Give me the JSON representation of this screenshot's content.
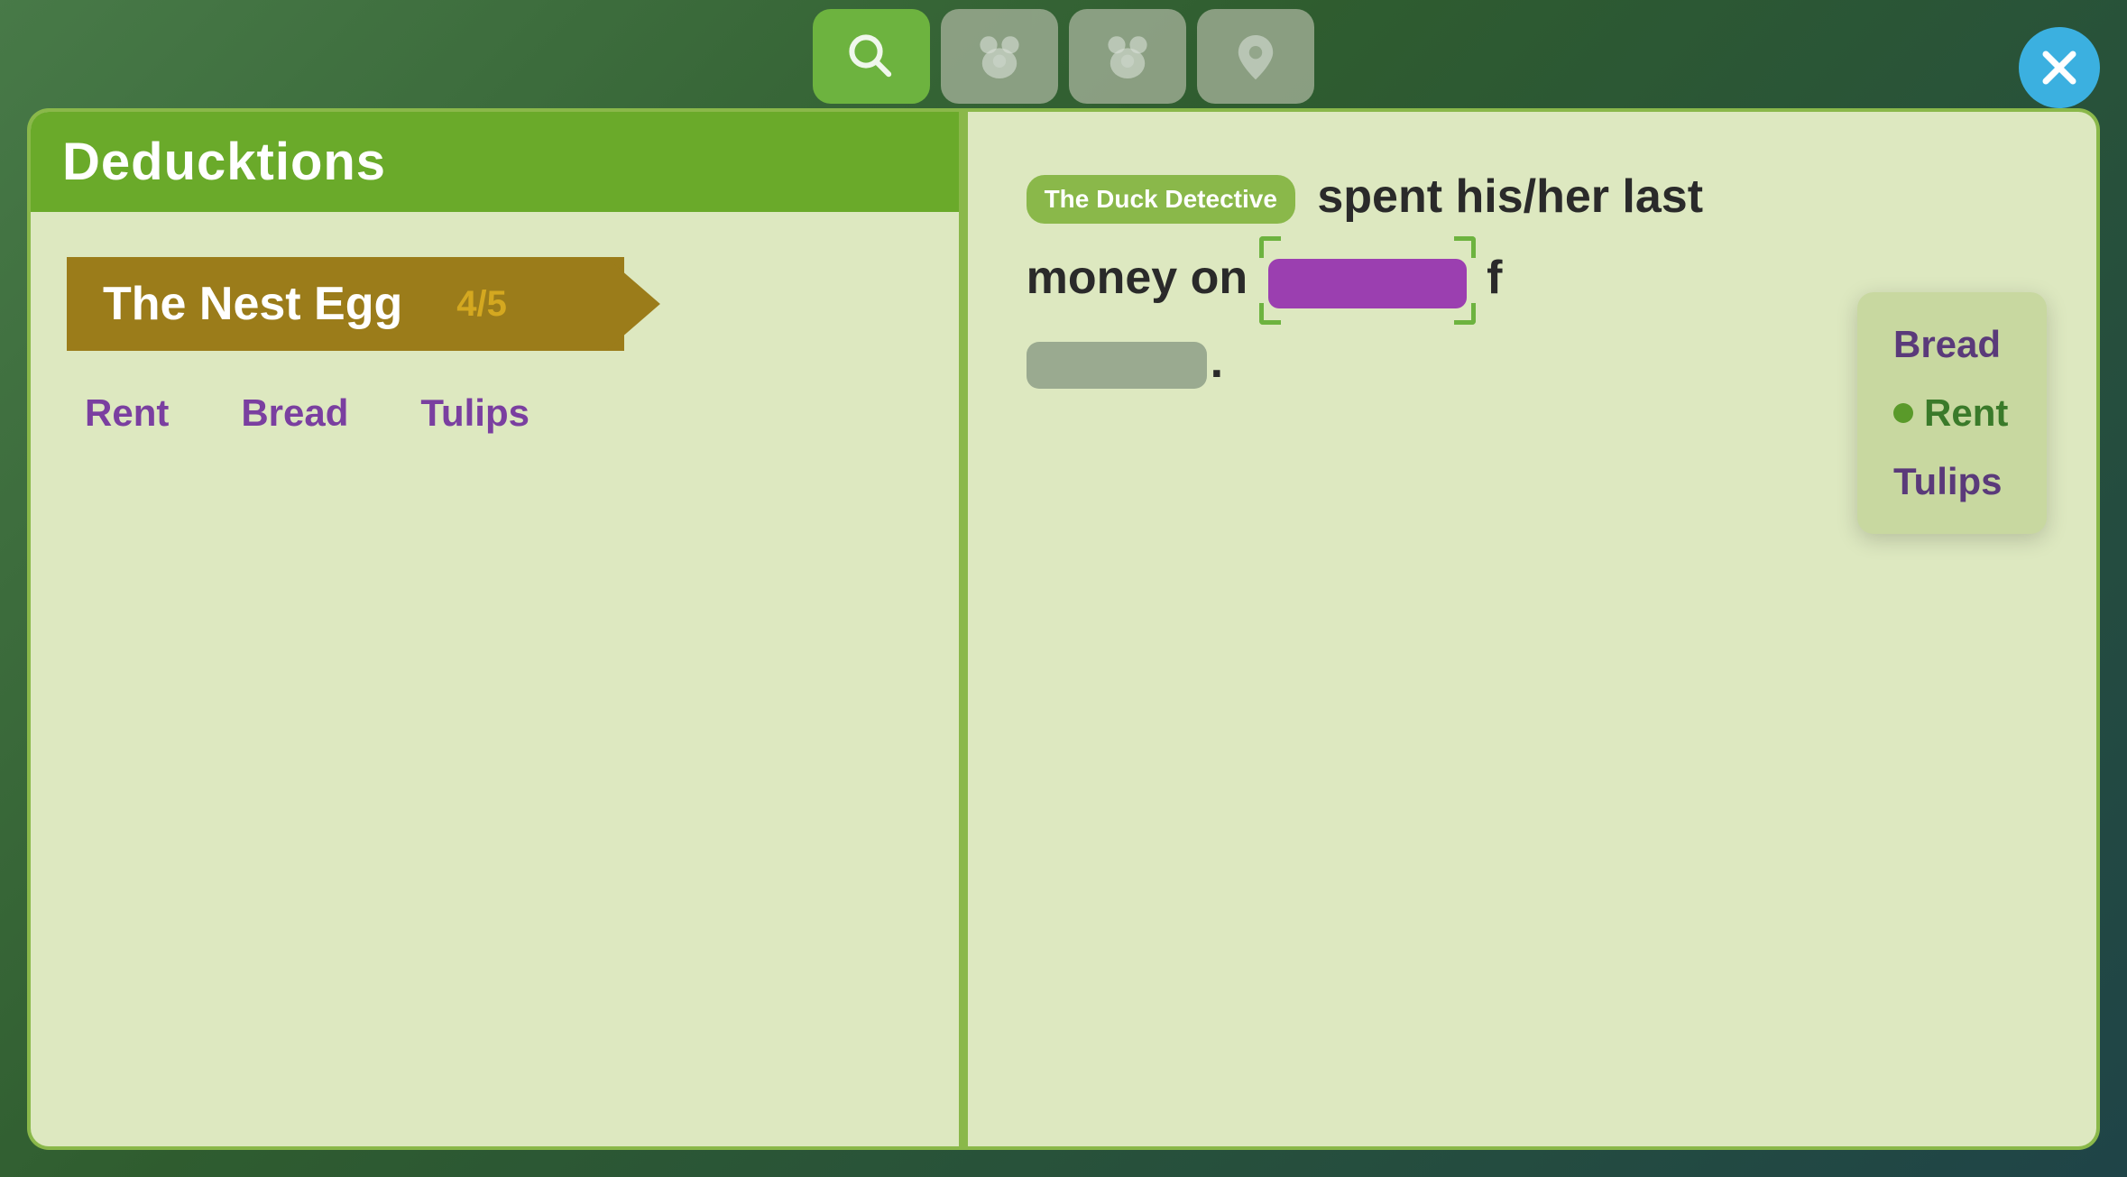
{
  "background": {
    "color": "#3a6b3a"
  },
  "topNav": {
    "tabs": [
      {
        "id": "search",
        "icon": "search",
        "active": true,
        "label": "Search Tab"
      },
      {
        "id": "bear1",
        "icon": "bear",
        "active": false,
        "label": "Bear Tab 1"
      },
      {
        "id": "bear2",
        "icon": "bear",
        "active": false,
        "label": "Bear Tab 2"
      },
      {
        "id": "location",
        "icon": "location",
        "active": false,
        "label": "Location Tab"
      }
    ]
  },
  "closeButton": {
    "label": "×"
  },
  "leftPage": {
    "header": {
      "title": "Deducktions"
    },
    "chapterBanner": {
      "title": "The Nest Egg",
      "progress": "4/5"
    },
    "clueItems": [
      "Rent",
      "Bread",
      "Tulips"
    ]
  },
  "rightPage": {
    "detectiveBadge": "The Duck Detective",
    "textParts": {
      "part1": "spent his/her last",
      "part2": "money on",
      "part3": "f",
      "endPunctuation": "."
    },
    "selectedBlank": "Rent",
    "answerBlankVisible": true
  },
  "dropdown": {
    "items": [
      {
        "label": "Bread",
        "selected": false
      },
      {
        "label": "Rent",
        "selected": true
      },
      {
        "label": "Tulips",
        "selected": false
      }
    ]
  }
}
